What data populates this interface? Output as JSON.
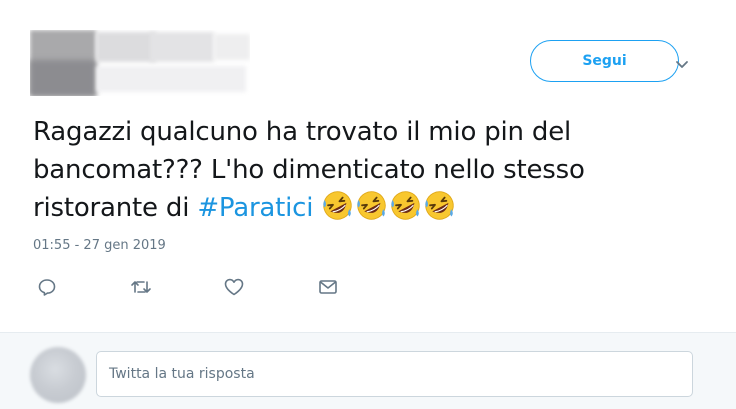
{
  "tweet": {
    "follow_label": "Segui",
    "text_line1": "Ragazzi qualcuno ha trovato il mio pin del",
    "text_line2": "bancomat??? L'ho dimenticato nello stesso",
    "text_line3_prefix": "ristorante di ",
    "hashtag": "#Paratici",
    "emoji_name": "rolling-on-the-floor-laughing",
    "emoji_count": 4,
    "timestamp": "01:55 - 27 gen 2019",
    "actions": [
      "reply-icon",
      "retweet-icon",
      "like-icon",
      "message-icon"
    ]
  },
  "reply": {
    "placeholder": "Twitta la tua risposta"
  },
  "colors": {
    "accent": "#1da1f2",
    "hashtag": "#1b95e0",
    "muted": "#657786",
    "text": "#14171a",
    "reply_bg": "#f5f8fa"
  }
}
